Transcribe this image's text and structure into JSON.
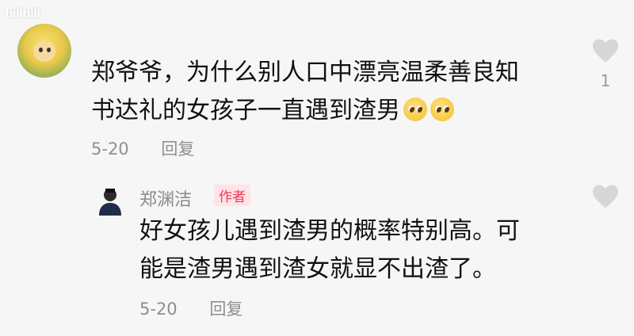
{
  "watermark": "bilibili",
  "comment": {
    "text_line1": "郑爷爷，为什么别人口中漂亮温柔善良知",
    "text_line2": "书达礼的女孩子一直遇到渣男",
    "emojis": [
      "pleading-face-emoji",
      "pleading-face-emoji"
    ],
    "date": "5-20",
    "reply_label": "回复",
    "like_count": "1"
  },
  "reply": {
    "author": "郑渊洁",
    "badge": "作者",
    "text_line1": "好女孩儿遇到渣男的概率特别高。可",
    "text_line2": "能是渣男遇到渣女就显不出渣了。",
    "date": "5-20",
    "reply_label": "回复"
  },
  "colors": {
    "background": "#f6f6f6",
    "badge_bg": "#ffe3e6",
    "badge_text": "#ee3a55",
    "meta_gray": "#8f8f8f"
  }
}
